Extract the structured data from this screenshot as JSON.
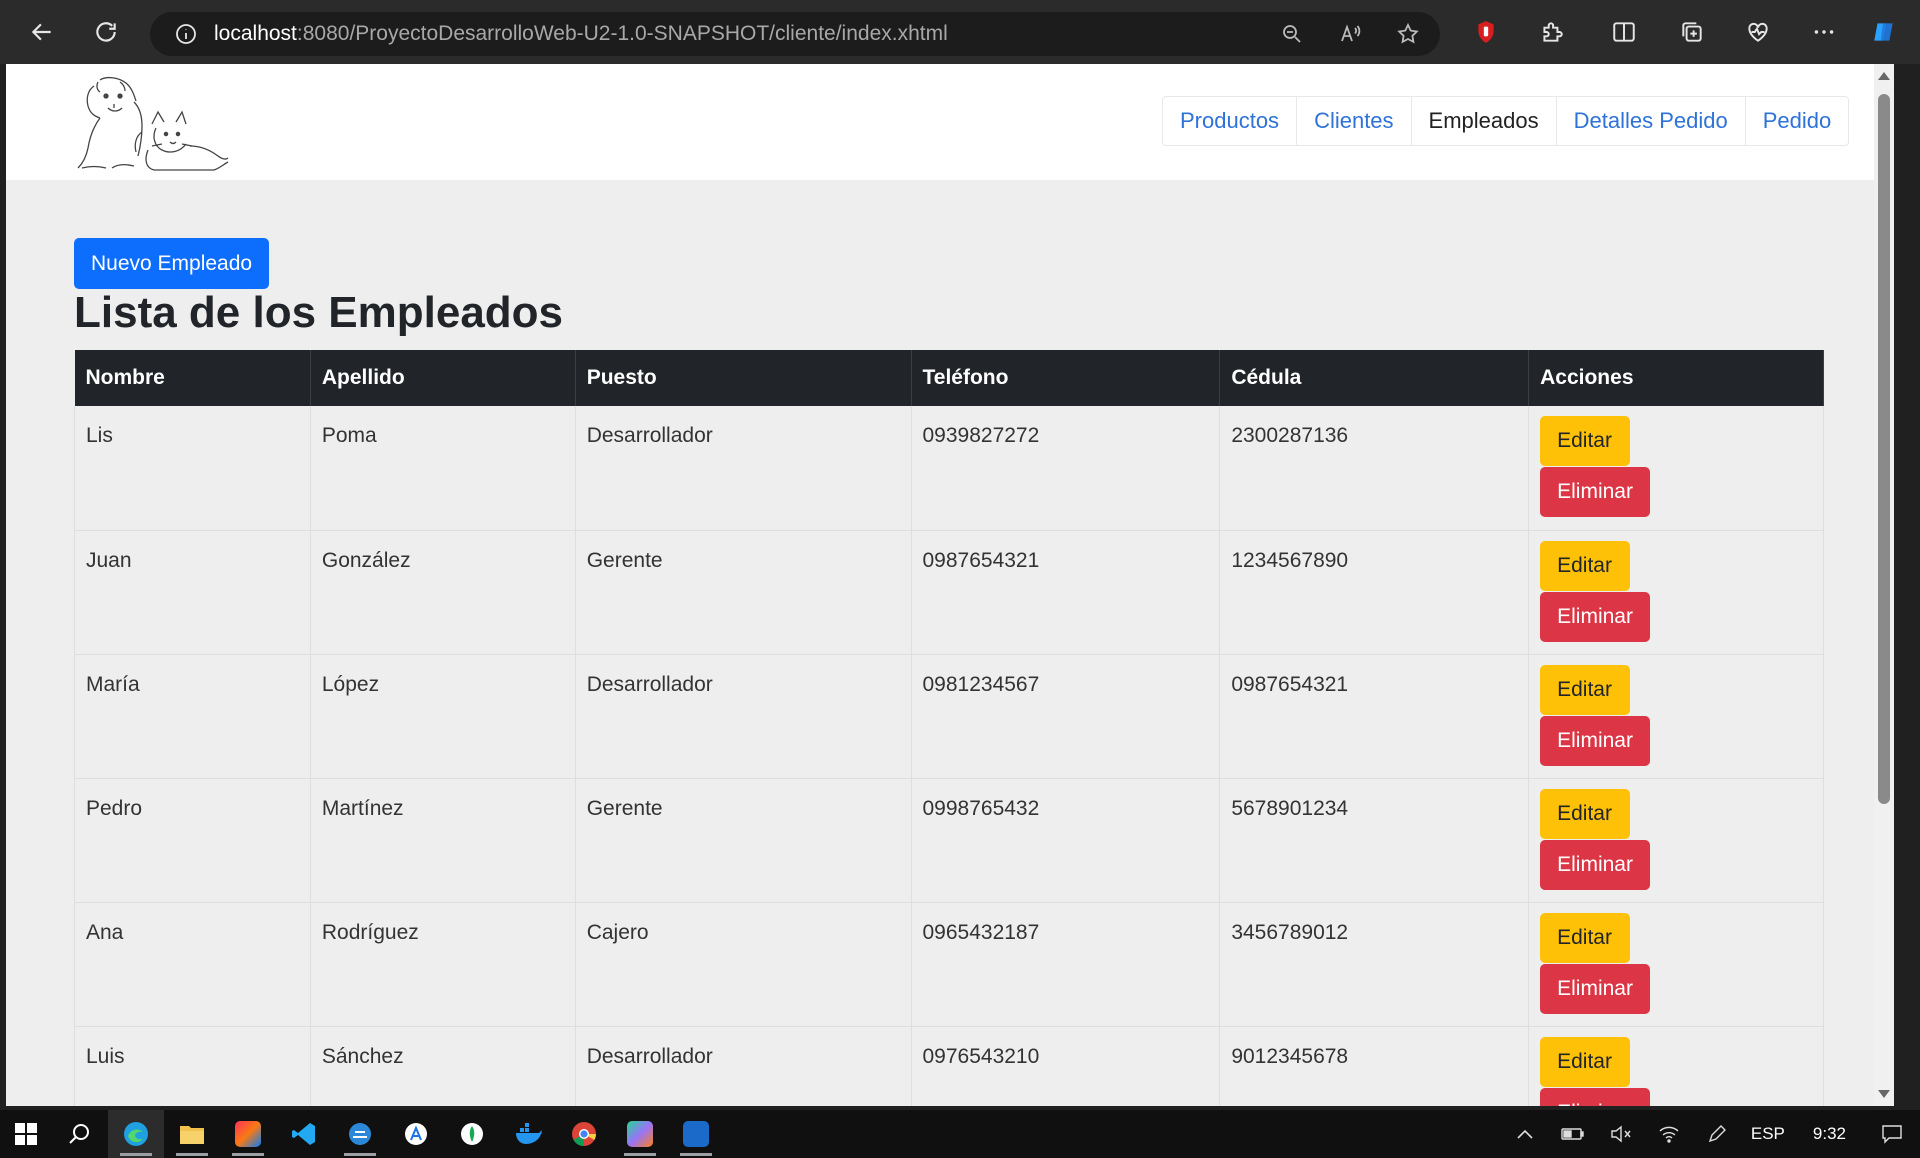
{
  "browser": {
    "url_host": "localhost",
    "url_rest": ":8080/ProyectoDesarrolloWeb-U2-1.0-SNAPSHOT/cliente/index.xhtml"
  },
  "nav": {
    "items": [
      {
        "label": "Productos",
        "active": false
      },
      {
        "label": "Clientes",
        "active": false
      },
      {
        "label": "Empleados",
        "active": true
      },
      {
        "label": "Detalles Pedido",
        "active": false
      },
      {
        "label": "Pedido",
        "active": false
      }
    ]
  },
  "page": {
    "new_button": "Nuevo Empleado",
    "title": "Lista de los Empleados"
  },
  "table": {
    "headers": [
      "Nombre",
      "Apellido",
      "Puesto",
      "Teléfono",
      "Cédula",
      "Acciones"
    ],
    "edit_label": "Editar",
    "delete_label": "Eliminar",
    "rows": [
      [
        "Lis",
        "Poma",
        "Desarrollador",
        "0939827272",
        "2300287136"
      ],
      [
        "Juan",
        "González",
        "Gerente",
        "0987654321",
        "1234567890"
      ],
      [
        "María",
        "López",
        "Desarrollador",
        "0981234567",
        "0987654321"
      ],
      [
        "Pedro",
        "Martínez",
        "Gerente",
        "0998765432",
        "5678901234"
      ],
      [
        "Ana",
        "Rodríguez",
        "Cajero",
        "0965432187",
        "3456789012"
      ],
      [
        "Luis",
        "Sánchez",
        "Desarrollador",
        "0976543210",
        "9012345678"
      ]
    ]
  },
  "taskbar": {
    "language": "ESP",
    "time": "9:32"
  },
  "colors": {
    "primary": "#0d6efd",
    "warning": "#ffc107",
    "danger": "#dc3545",
    "table_header": "#212529",
    "nav_link": "#2f72d8"
  }
}
